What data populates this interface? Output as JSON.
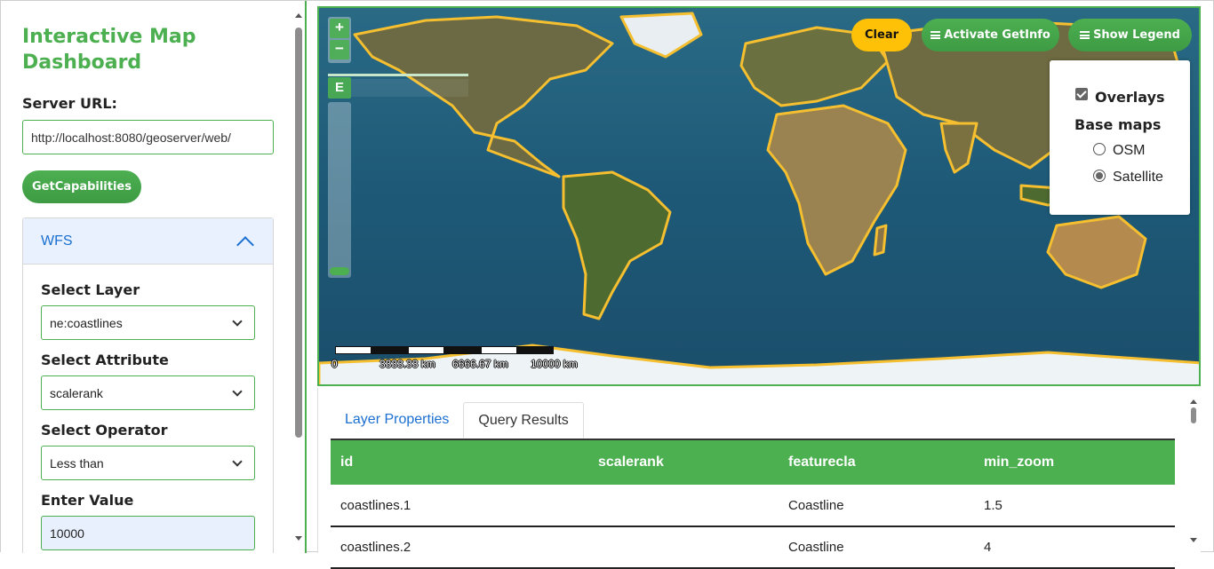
{
  "sidebar": {
    "title": "Interactive Map Dashboard",
    "server_url_label": "Server URL:",
    "server_url_value": "http://localhost:8080/geoserver/web/",
    "getcapabilities_label": "GetCapabilities",
    "accordion": {
      "title": "WFS",
      "select_layer_label": "Select Layer",
      "select_layer_value": "ne:coastlines",
      "select_attribute_label": "Select Attribute",
      "select_attribute_value": "scalerank",
      "select_operator_label": "Select Operator",
      "select_operator_value": "Less than",
      "enter_value_label": "Enter Value",
      "enter_value_value": "10000"
    }
  },
  "map": {
    "zoom_in": "+",
    "zoom_out": "−",
    "extent_button": "E",
    "clear_label": "Clear",
    "getinfo_label": "Activate GetInfo",
    "legend_label": "Show Legend",
    "layer_switcher": {
      "overlays_label": "Overlays",
      "overlays_checked": true,
      "basemaps_label": "Base maps",
      "options": [
        "OSM",
        "Satellite"
      ],
      "selected": "Satellite"
    },
    "scale_labels": [
      "0",
      "3333.33 km",
      "6666.67 km",
      "10000 km"
    ],
    "colors": {
      "accent": "#4caf50",
      "clear": "#ffc107",
      "coastline": "#f5bf2f"
    }
  },
  "results": {
    "tabs": [
      "Layer Properties",
      "Query Results"
    ],
    "active_tab": "Query Results",
    "columns": [
      "id",
      "scalerank",
      "featurecla",
      "min_zoom"
    ],
    "rows": [
      [
        "coastlines.1",
        "",
        "Coastline",
        "1.5"
      ],
      [
        "coastlines.2",
        "",
        "Coastline",
        "4"
      ]
    ]
  }
}
